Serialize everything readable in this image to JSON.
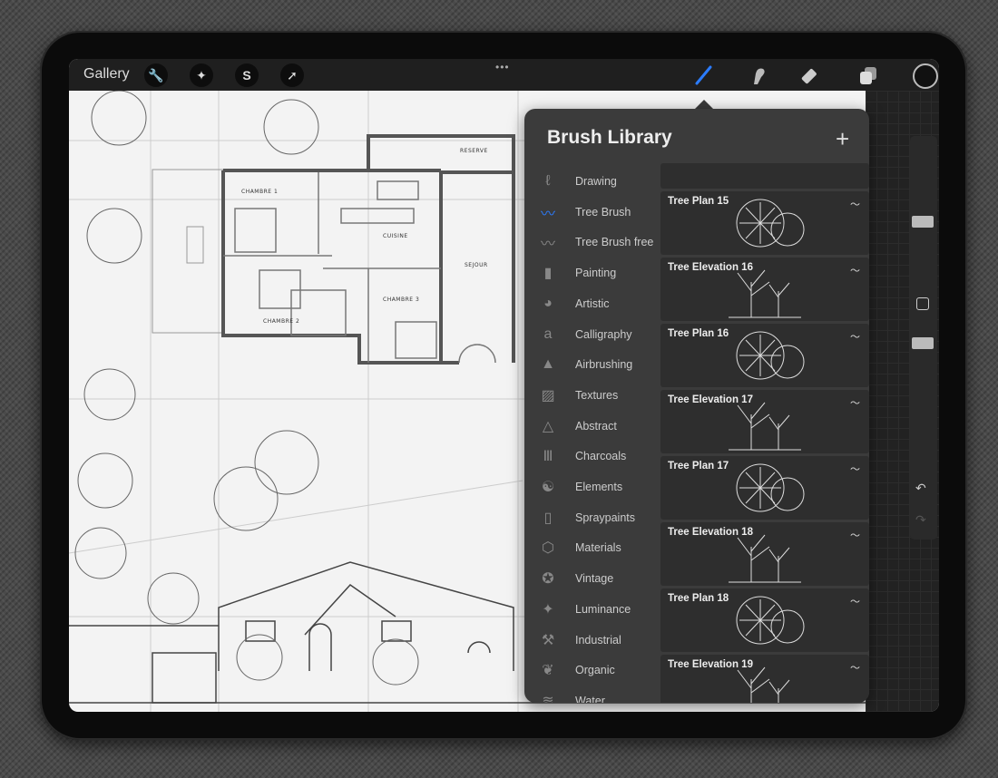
{
  "toolbar": {
    "gallery_label": "Gallery",
    "left_tools": [
      {
        "icon": "wrench-icon",
        "glyph": "🔧"
      },
      {
        "icon": "magic-wand-icon",
        "glyph": "✦"
      },
      {
        "icon": "selection-icon",
        "glyph": "S"
      },
      {
        "icon": "transform-arrow-icon",
        "glyph": "➚"
      }
    ],
    "more_glyph": "•••",
    "accent_color": "#2b7cff"
  },
  "brush_library": {
    "title": "Brush Library",
    "add_glyph": "+",
    "categories": [
      {
        "label": "Drawing",
        "glyph": "ℓ"
      },
      {
        "label": "Tree Brush",
        "glyph": "〰",
        "active": true
      },
      {
        "label": "Tree Brush free",
        "glyph": "〰"
      },
      {
        "label": "Painting",
        "glyph": "▮"
      },
      {
        "label": "Artistic",
        "glyph": "◕"
      },
      {
        "label": "Calligraphy",
        "glyph": "a"
      },
      {
        "label": "Airbrushing",
        "glyph": "▲"
      },
      {
        "label": "Textures",
        "glyph": "▨"
      },
      {
        "label": "Abstract",
        "glyph": "△"
      },
      {
        "label": "Charcoals",
        "glyph": "Ⅲ"
      },
      {
        "label": "Elements",
        "glyph": "☯"
      },
      {
        "label": "Spraypaints",
        "glyph": "▯"
      },
      {
        "label": "Materials",
        "glyph": "⬡"
      },
      {
        "label": "Vintage",
        "glyph": "✪"
      },
      {
        "label": "Luminance",
        "glyph": "✦"
      },
      {
        "label": "Industrial",
        "glyph": "⚒"
      },
      {
        "label": "Organic",
        "glyph": "❦"
      },
      {
        "label": "Water",
        "glyph": "≋"
      }
    ],
    "brushes": [
      {
        "name": "Tree Plan 15"
      },
      {
        "name": "Tree Elevation 16"
      },
      {
        "name": "Tree Plan 16"
      },
      {
        "name": "Tree Elevation 17"
      },
      {
        "name": "Tree Plan 17"
      },
      {
        "name": "Tree Elevation 18"
      },
      {
        "name": "Tree Plan 18"
      },
      {
        "name": "Tree Elevation 19"
      }
    ]
  },
  "floor_plan": {
    "rooms": [
      "CHAMBRE 1",
      "CUISINE",
      "RESERVE",
      "SEJOUR",
      "CHAMBRE 2",
      "CHAMBRE 3"
    ]
  }
}
